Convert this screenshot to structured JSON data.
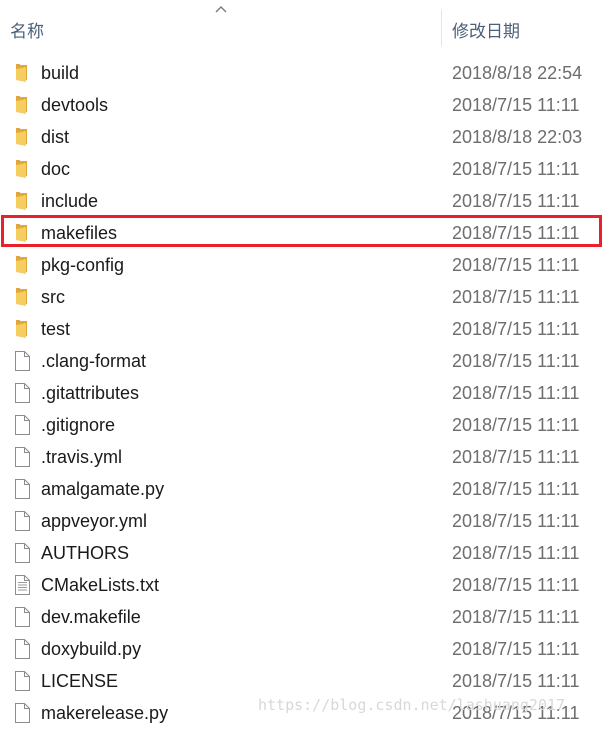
{
  "header": {
    "name_label": "名称",
    "date_label": "修改日期"
  },
  "files": [
    {
      "name": "build",
      "date": "2018/8/18 22:54",
      "icon": "folder-icon"
    },
    {
      "name": "devtools",
      "date": "2018/7/15 11:11",
      "icon": "folder-icon"
    },
    {
      "name": "dist",
      "date": "2018/8/18 22:03",
      "icon": "folder-icon"
    },
    {
      "name": "doc",
      "date": "2018/7/15 11:11",
      "icon": "folder-icon"
    },
    {
      "name": "include",
      "date": "2018/7/15 11:11",
      "icon": "folder-icon"
    },
    {
      "name": "makefiles",
      "date": "2018/7/15 11:11",
      "icon": "folder-icon"
    },
    {
      "name": "pkg-config",
      "date": "2018/7/15 11:11",
      "icon": "folder-icon"
    },
    {
      "name": "src",
      "date": "2018/7/15 11:11",
      "icon": "folder-icon"
    },
    {
      "name": "test",
      "date": "2018/7/15 11:11",
      "icon": "folder-icon"
    },
    {
      "name": ".clang-format",
      "date": "2018/7/15 11:11",
      "icon": "file-icon"
    },
    {
      "name": ".gitattributes",
      "date": "2018/7/15 11:11",
      "icon": "file-icon"
    },
    {
      "name": ".gitignore",
      "date": "2018/7/15 11:11",
      "icon": "file-icon"
    },
    {
      "name": ".travis.yml",
      "date": "2018/7/15 11:11",
      "icon": "file-icon"
    },
    {
      "name": "amalgamate.py",
      "date": "2018/7/15 11:11",
      "icon": "file-icon"
    },
    {
      "name": "appveyor.yml",
      "date": "2018/7/15 11:11",
      "icon": "file-icon"
    },
    {
      "name": "AUTHORS",
      "date": "2018/7/15 11:11",
      "icon": "file-icon"
    },
    {
      "name": "CMakeLists.txt",
      "date": "2018/7/15 11:11",
      "icon": "text-file-icon"
    },
    {
      "name": "dev.makefile",
      "date": "2018/7/15 11:11",
      "icon": "file-icon"
    },
    {
      "name": "doxybuild.py",
      "date": "2018/7/15 11:11",
      "icon": "file-icon"
    },
    {
      "name": "LICENSE",
      "date": "2018/7/15 11:11",
      "icon": "file-icon"
    },
    {
      "name": "makerelease.py",
      "date": "2018/7/15 11:11",
      "icon": "file-icon"
    }
  ],
  "highlighted_item": "makefiles",
  "watermark": "https://blog.csdn.net/lashuang2017",
  "colors": {
    "highlight_border": "#e8212a",
    "folder": "#f3c24f",
    "header_text": "#4c607a"
  }
}
